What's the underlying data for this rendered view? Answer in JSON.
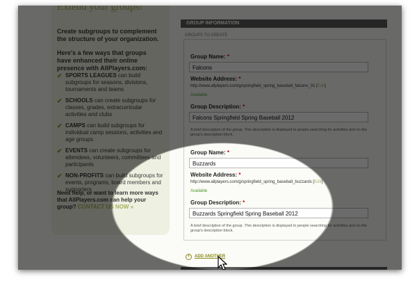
{
  "sidebar": {
    "title": "Extend your groups!",
    "intro": "Create subgroups to complement the structure of your organization.",
    "intro2": "Here's a few ways that groups have enhanced their online presence with AllPlayers.com:",
    "items": [
      {
        "title": "SPORTS LEAGUES",
        "text": " can build subgroups for seasons, divisions, tournaments and teams"
      },
      {
        "title": "SCHOOLS",
        "text": " can create subgroups for classes, grades, extracurricular activities and clubs"
      },
      {
        "title": "CAMPS",
        "text": " can build subgroups for individual camp sessions, activities and age groups"
      },
      {
        "title": "EVENTS",
        "text": " can create subgroups for attendees, volunteers, committees and participants"
      },
      {
        "title": "NON-PROFITS",
        "text": " can build subgroups for events, programs, board members and supporters"
      }
    ],
    "help_text": "Need help, or want to learn more ways that AllPlayers.com can help your group? ",
    "contact_link": "CONTACT US NOW »"
  },
  "main": {
    "header": "GROUP INFORMATION",
    "section_label": "GROUPS TO CREATE",
    "groups": [
      {
        "name_label": "Group Name:",
        "name_value": "Falcons",
        "website_label": "Website Address:",
        "url": "http://www.allplayers.com/g/springfield_spring_baseball_falcons_01",
        "edit_link": "Edit",
        "available": "Available",
        "desc_label": "Group Description:",
        "desc_value": "Falcons Springfield Spring Baseball 2012",
        "hint": "A brief description of the group. This description is displayed to people searching for activities and on the group's description block."
      },
      {
        "name_label": "Group Name:",
        "name_value": "Buzzards",
        "website_label": "Website Address:",
        "url": "http://www.allplayers.com/g/springfield_spring_baseball_buzzards",
        "edit_link": "Edit",
        "available": "Available",
        "desc_label": "Group Description:",
        "desc_value": "Buzzards Springfield Spring Baseball 2012",
        "hint": "A brief description of the group. This description is displayed to people searching for activities and on the group's description block."
      }
    ],
    "add_another": "ADD ANOTHER",
    "required_mark": "*"
  },
  "colors": {
    "accent": "#a7b15a",
    "available": "#4a9a2a",
    "header_bg": "#5c5c5c"
  }
}
